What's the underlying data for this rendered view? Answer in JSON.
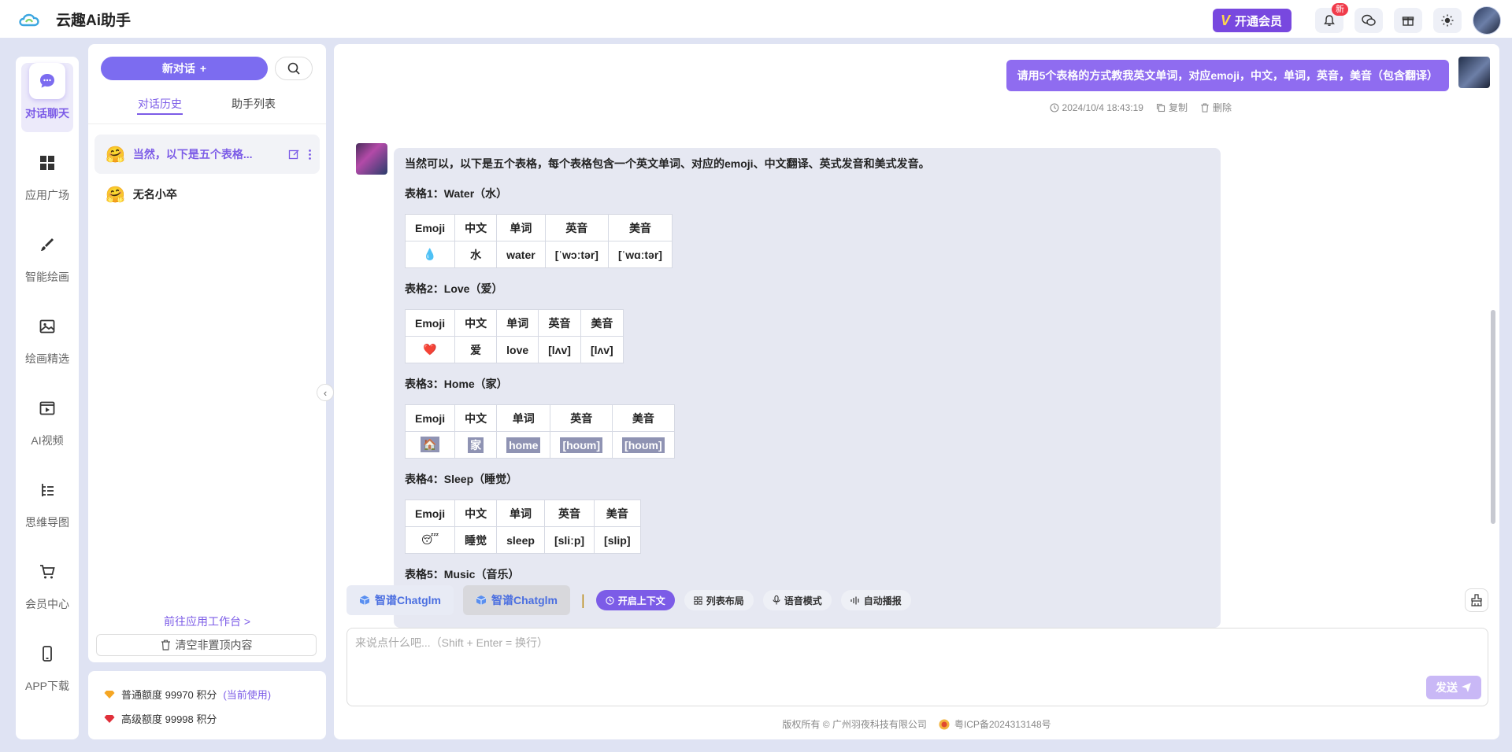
{
  "app": {
    "title": "云趣Ai助手"
  },
  "header": {
    "vip_label": "开通会员",
    "notice_badge": "新"
  },
  "nav": [
    {
      "label": "对话聊天"
    },
    {
      "label": "应用广场"
    },
    {
      "label": "智能绘画"
    },
    {
      "label": "绘画精选"
    },
    {
      "label": "AI视频"
    },
    {
      "label": "思维导图"
    },
    {
      "label": "会员中心"
    },
    {
      "label": "APP下载"
    }
  ],
  "conv": {
    "new_chat": "新对话",
    "tabs": [
      "对话历史",
      "助手列表"
    ],
    "items": [
      {
        "title": "当然，以下是五个表格..."
      },
      {
        "title": "无名小卒"
      }
    ],
    "goto": "前往应用工作台 >",
    "clear": "清空非置顶内容"
  },
  "quota": {
    "normal": "普通额度 99970 积分",
    "normal_current": "(当前使用)",
    "premium": "高级额度 99998 积分"
  },
  "chat": {
    "user_text": "请用5个表格的方式教我英文单词，对应emoji，中文，单词，英音，美音（包含翻译）",
    "time": "2024/10/4 18:43:19",
    "copy": "复制",
    "delete": "删除",
    "intro": "当然可以，以下是五个表格，每个表格包含一个英文单词、对应的emoji、中文翻译、英式发音和美式发音。",
    "headers": [
      "Emoji",
      "中文",
      "单词",
      "英音",
      "美音"
    ],
    "tables": [
      {
        "title": "表格1：Water（水）",
        "row": [
          "💧",
          "水",
          "water",
          "[ˈwɔːtər]",
          "[ˈwɑːtər]"
        ]
      },
      {
        "title": "表格2：Love（爱）",
        "row": [
          "❤️",
          "爱",
          "love",
          "[lʌv]",
          "[lʌv]"
        ]
      },
      {
        "title": "表格3：Home（家）",
        "row": [
          "🏠",
          "家",
          "home",
          "[hoʊm]",
          "[hoʊm]"
        ]
      },
      {
        "title": "表格4：Sleep（睡觉）",
        "row": [
          "😴",
          "睡觉",
          "sleep",
          "[sliːp]",
          "[slip]"
        ]
      },
      {
        "title": "表格5：Music（音乐）"
      }
    ]
  },
  "toolbar": {
    "model1": "智谱Chatglm",
    "model2": "智谱Chatglm",
    "context": "开启上下文",
    "layout": "列表布局",
    "voice": "语音模式",
    "autoplay": "自动播报"
  },
  "input": {
    "placeholder": "来说点什么吧...（Shift + Enter = 换行）",
    "send": "发送"
  },
  "footer": {
    "copyright": "版权所有 © 广州羽夜科技有限公司",
    "icp": "粤ICP备2024313148号"
  },
  "colors": {
    "accent": "#7c5ce7",
    "vip": "#7848df"
  }
}
